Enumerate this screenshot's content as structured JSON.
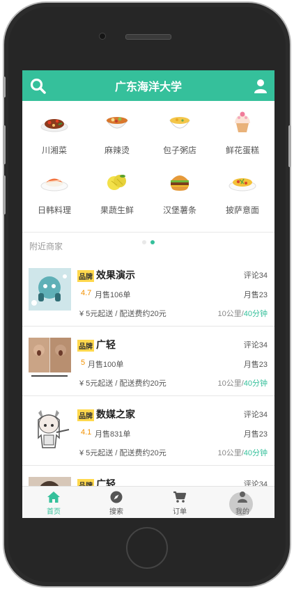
{
  "header": {
    "title": "广东海洋大学"
  },
  "categories": [
    {
      "label": "川湘菜"
    },
    {
      "label": "麻辣烫"
    },
    {
      "label": "包子粥店"
    },
    {
      "label": "鲜花蛋糕"
    },
    {
      "label": "日韩料理"
    },
    {
      "label": "果蔬生鲜"
    },
    {
      "label": "汉堡薯条"
    },
    {
      "label": "披萨意面"
    }
  ],
  "section_title": "附近商家",
  "shops": [
    {
      "badge": "品牌",
      "name": "效果演示",
      "reviews": "评论34",
      "rating": "4.7",
      "monthly": "月售106单",
      "sold": "月售23",
      "delivery": "¥ 5元起送 / 配送费约20元",
      "distance": "10公里/",
      "time": "40分钟"
    },
    {
      "badge": "品牌",
      "name": "广轻",
      "reviews": "评论34",
      "rating": "5",
      "monthly": "月售100单",
      "sold": "月售23",
      "delivery": "¥ 5元起送 / 配送费约20元",
      "distance": "10公里/",
      "time": "40分钟"
    },
    {
      "badge": "品牌",
      "name": "数媒之家",
      "reviews": "评论34",
      "rating": "4.1",
      "monthly": "月售831单",
      "sold": "月售23",
      "delivery": "¥ 5元起送 / 配送费约20元",
      "distance": "10公里/",
      "time": "40分钟"
    },
    {
      "badge": "品牌",
      "name": "广轻",
      "reviews": "评论34",
      "rating": "",
      "monthly": "",
      "sold": "",
      "delivery": "",
      "distance": "",
      "time": ""
    }
  ],
  "tabs": [
    {
      "label": "首页",
      "icon": "home-icon"
    },
    {
      "label": "搜索",
      "icon": "compass-icon"
    },
    {
      "label": "订单",
      "icon": "cart-icon"
    },
    {
      "label": "我的",
      "icon": "user-icon"
    }
  ],
  "colors": {
    "accent": "#35c09b",
    "rating": "#f29100",
    "badge": "#ffd84d"
  }
}
